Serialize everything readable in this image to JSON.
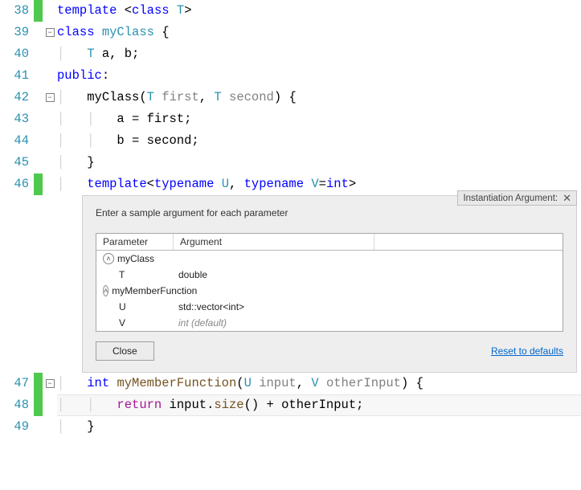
{
  "lines": {
    "38": {
      "num": "38"
    },
    "39": {
      "num": "39"
    },
    "40": {
      "num": "40"
    },
    "41": {
      "num": "41"
    },
    "42": {
      "num": "42"
    },
    "43": {
      "num": "43"
    },
    "44": {
      "num": "44"
    },
    "45": {
      "num": "45"
    },
    "46": {
      "num": "46"
    },
    "47": {
      "num": "47"
    },
    "48": {
      "num": "48"
    },
    "49": {
      "num": "49"
    }
  },
  "tok": {
    "template": "template",
    "class": "class",
    "myClass": "myClass",
    "T": "T",
    "a_b": "a, b;",
    "public": "public",
    "ctor_open": "(",
    "first": "first",
    "second": "second",
    "comma": ", ",
    "close_brace_ctor": "{",
    "a_eq": "a = first;",
    "b_eq": "b = second;",
    "rbrace": "}",
    "typename": "typename",
    "U": "U",
    "V": "V",
    "eqint": "=",
    "int": "int",
    "gt": ">",
    "lt": "<",
    "intkw": "int",
    "myMemberFunction": "myMemberFunction",
    "input": "input",
    "otherInput": "otherInput",
    "returnkw": "return",
    "size": "size",
    "plus": " + ",
    "semi": ";",
    "paren_open": "(",
    "paren_close": ")",
    "brace_open": " {",
    "dot": "."
  },
  "popup": {
    "tag": "Instantiation Argument:",
    "instruction": "Enter a sample argument for each parameter",
    "col_param": "Parameter",
    "col_arg": "Argument",
    "group1": "myClass",
    "row_T_param": "T",
    "row_T_arg": "double",
    "group2": "myMemberFunction",
    "row_U_param": "U",
    "row_U_arg": "std::vector<int>",
    "row_V_param": "V",
    "row_V_arg": "int (default)",
    "close": "Close",
    "reset": "Reset to defaults"
  }
}
